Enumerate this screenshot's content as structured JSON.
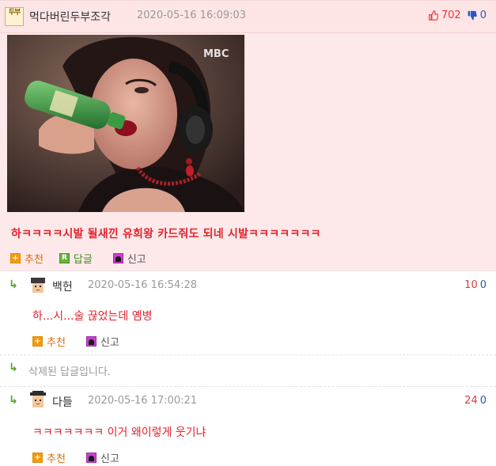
{
  "best_comment": {
    "level_badge": "두부",
    "nickname": "먹다버린두부조각",
    "date": "2020-05-16 16:09:03",
    "upvotes": "702",
    "downvotes": "0",
    "text": "하ㅋㅋㅋㅋ시발 될새낀 유희왕 카드줘도 되네 시발ㅋㅋㅋㅋㅋㅋㅋ",
    "actions": {
      "recommend": "추천",
      "reply": "답글",
      "report": "신고"
    },
    "image_watermark": "MBC"
  },
  "replies": [
    {
      "nickname": "백헌",
      "date": "2020-05-16 16:54:28",
      "upvotes": "10",
      "downvotes": "0",
      "text": "하...시...술 끊었는데 옘병",
      "actions": {
        "recommend": "추천",
        "report": "신고"
      }
    },
    {
      "deleted_text": "삭제된 답글입니다."
    },
    {
      "nickname": "다들",
      "date": "2020-05-16 17:00:21",
      "upvotes": "24",
      "downvotes": "0",
      "text": "ㅋㅋㅋㅋㅋㅋㅋ 이거 왜이렇게 웃기냐",
      "actions": {
        "recommend": "추천",
        "report": "신고"
      }
    }
  ],
  "colors": {
    "best_bg": "#fee9ea",
    "comment_text": "#e2242e",
    "upvote": "#e23939",
    "downvote": "#2a56c6",
    "reply_arrow": "#4fa12b"
  }
}
